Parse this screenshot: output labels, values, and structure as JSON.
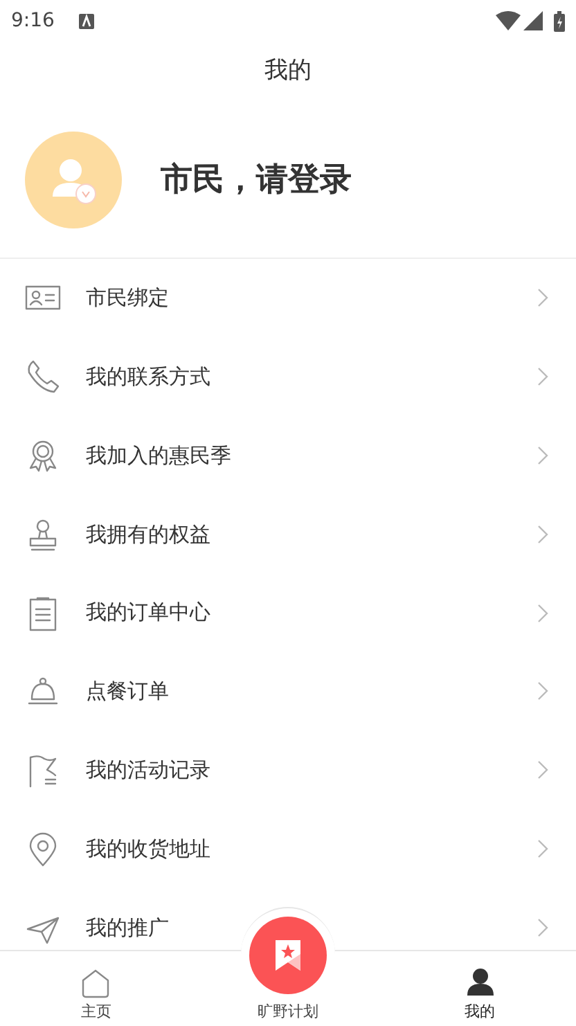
{
  "status_bar": {
    "time": "9:16"
  },
  "header": {
    "title": "我的"
  },
  "profile": {
    "prompt": "市民，请登录"
  },
  "menu": [
    {
      "kind": "id-card",
      "label": "市民绑定"
    },
    {
      "kind": "phone",
      "label": "我的联系方式"
    },
    {
      "kind": "medal",
      "label": "我加入的惠民季"
    },
    {
      "kind": "stamp",
      "label": "我拥有的权益"
    },
    {
      "kind": "clipboard",
      "label": "我的订单中心"
    },
    {
      "kind": "bell",
      "label": "点餐订单"
    },
    {
      "kind": "flag",
      "label": "我的活动记录"
    },
    {
      "kind": "pin",
      "label": "我的收货地址"
    },
    {
      "kind": "plane",
      "label": "我的推广"
    }
  ],
  "tab_bar": [
    {
      "kind": "home",
      "label": "主页",
      "selected": false
    },
    {
      "kind": "center",
      "label": "旷野计划",
      "selected": false
    },
    {
      "kind": "person",
      "label": "我的",
      "selected": true
    }
  ]
}
